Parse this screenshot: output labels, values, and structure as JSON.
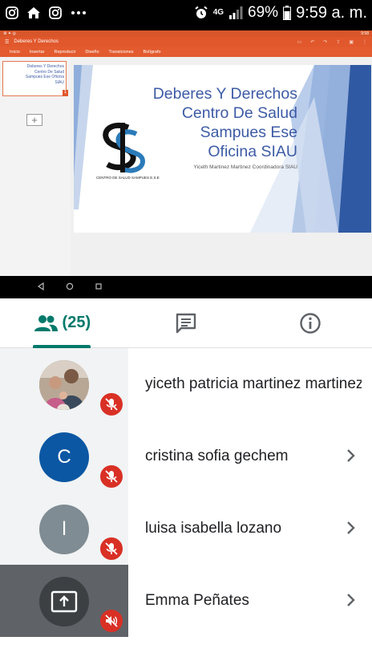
{
  "status_bar": {
    "network": "4G",
    "battery": "69%",
    "time": "9:59 a. m.",
    "icons": [
      "instagram-icon",
      "home-icon",
      "instagram-icon",
      "more-icon",
      "alarm-icon",
      "signal-icon",
      "battery-icon"
    ]
  },
  "shared_screen": {
    "app_title": "Deberes Y Derechos",
    "mini_time": "9:58",
    "menu": [
      "Inicio",
      "Insertar",
      "Reproducir",
      "Diseño",
      "Transiciones",
      "Bolígrafo"
    ],
    "thumbnail_text": "Deberes Y Derechos Centro De Salud Sampues Ese Oficina SIAU",
    "thumbnail_number": "1",
    "add_slide": "+",
    "slide": {
      "title_lines": [
        "Deberes Y Derechos",
        "Centro De Salud",
        "Sampues Ese",
        "Oficina SIAU"
      ],
      "subtitle": "Yiceth  Martinez Martinez Coordinadora SIAU",
      "logo_caption": "CENTRO DE SALUD SAMPUES E.S.E",
      "accent_color": "#3d5ba5"
    }
  },
  "tabs": [
    {
      "name": "people",
      "icon": "people-icon",
      "label": "(25)"
    },
    {
      "name": "chat",
      "icon": "chat-icon",
      "label": ""
    },
    {
      "name": "info",
      "icon": "info-icon",
      "label": ""
    }
  ],
  "participants": [
    {
      "name": "yiceth patricia martinez martinez",
      "avatar_type": "photo",
      "initial": "",
      "avatar_color": "#8d7b6a",
      "muted": true,
      "chevron": false
    },
    {
      "name": "cristina sofia gechem",
      "avatar_type": "initial",
      "initial": "C",
      "avatar_color": "#0b57a3",
      "muted": true,
      "chevron": true
    },
    {
      "name": "luisa isabella lozano",
      "avatar_type": "initial",
      "initial": "l",
      "avatar_color": "#7f8c93",
      "muted": true,
      "chevron": true
    },
    {
      "name": "Emma Peñates",
      "avatar_type": "presenting",
      "initial": "",
      "avatar_color": "#3c4043",
      "muted": true,
      "chevron": true
    }
  ],
  "colors": {
    "accent": "#00796b",
    "mute": "#d93025",
    "office_orange": "#e1582c"
  }
}
